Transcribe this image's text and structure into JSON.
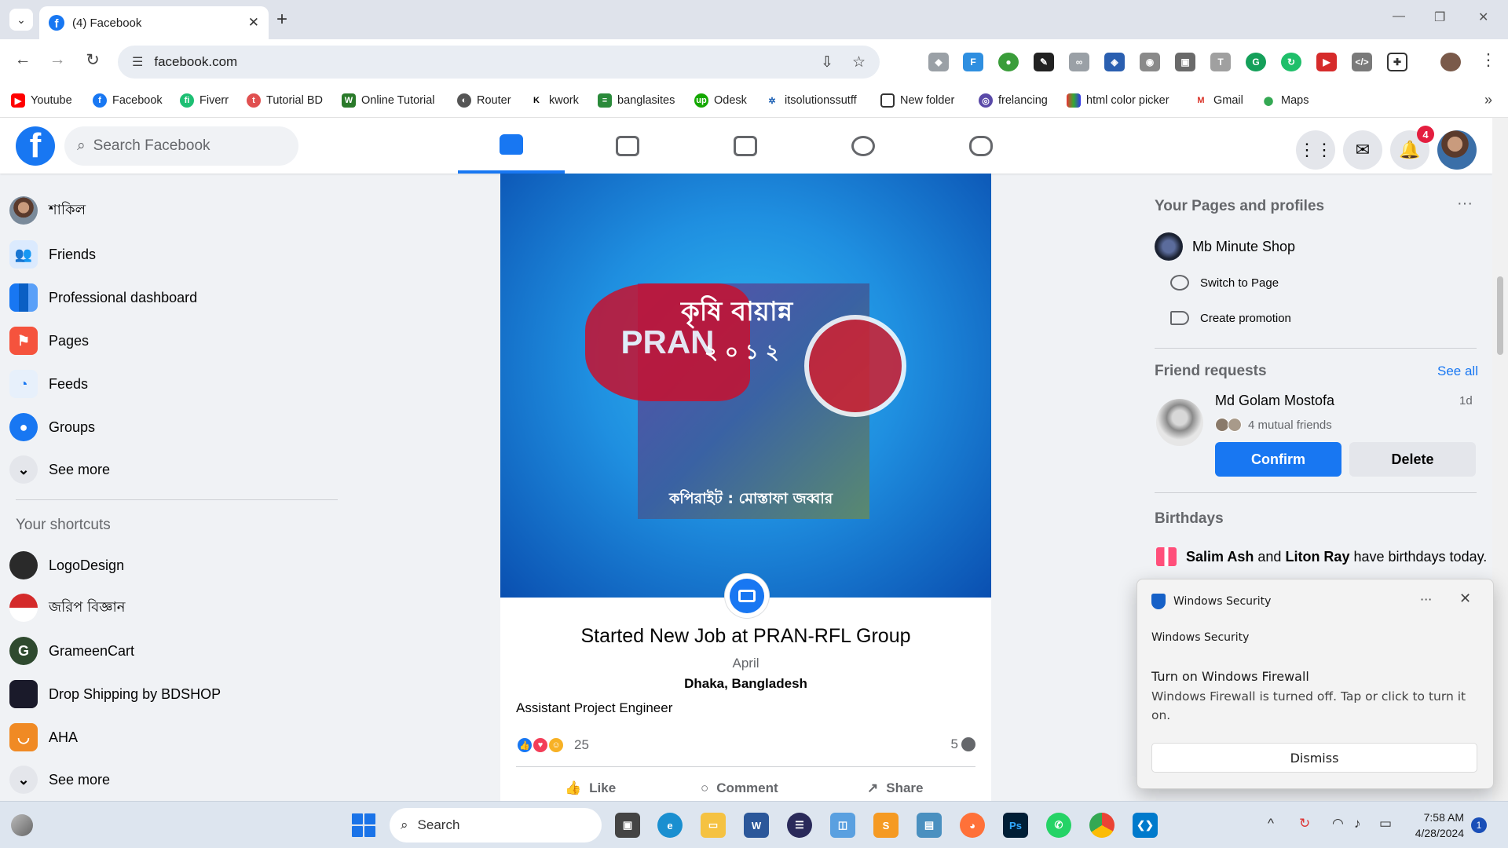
{
  "browser": {
    "tab_title": "(4) Facebook",
    "url": "facebook.com",
    "bookmarks": [
      "Youtube",
      "Facebook",
      "Fiverr",
      "Tutorial BD",
      "Online Tutorial",
      "Router",
      "kwork",
      "banglasites",
      "Odesk",
      "itsolutionssutff",
      "New folder",
      "frelancing",
      "html color picker",
      "Gmail",
      "Maps"
    ]
  },
  "header": {
    "search_placeholder": "Search Facebook",
    "notification_count": "4",
    "nav_tabs": [
      "home",
      "watch",
      "marketplace",
      "groups",
      "gaming"
    ]
  },
  "left_nav": {
    "items": [
      "শাকিল",
      "Friends",
      "Professional dashboard",
      "Pages",
      "Feeds",
      "Groups",
      "See more"
    ],
    "shortcuts_title": "Your shortcuts",
    "shortcuts": [
      "LogoDesign",
      "জরিপ বিজ্ঞান",
      "GrameenCart",
      "Drop Shipping by BDSHOP",
      "AHA",
      "See more"
    ]
  },
  "post": {
    "cover_text_top": "কৃষি বায়ান্ন",
    "cover_text_mid": "২ ০ ১ ২",
    "cover_text_bottom": "কপিরাইট : মোস্তাফা জব্বার",
    "cover_brand": "PRAN",
    "title": "Started New Job at PRAN-RFL Group",
    "date": "April",
    "location": "Dhaka, Bangladesh",
    "role": "Assistant Project Engineer",
    "reaction_count": "25",
    "comment_count": "5",
    "actions": [
      "Like",
      "Comment",
      "Share"
    ]
  },
  "right": {
    "pages_title": "Your Pages and profiles",
    "page_name": "Mb Minute Shop",
    "switch_label": "Switch to Page",
    "promo_label": "Create promotion",
    "requests_title": "Friend requests",
    "see_all": "See all",
    "request_name": "Md Golam Mostofa",
    "request_time": "1d",
    "mutual": "4 mutual friends",
    "confirm": "Confirm",
    "delete": "Delete",
    "birthdays_title": "Birthdays",
    "bday_name1": "Salim Ash",
    "bday_and": "and",
    "bday_name2": "Liton Ray",
    "bday_text": "have birthdays today."
  },
  "toast": {
    "app": "Windows Security",
    "subtitle": "Windows Security",
    "headline": "Turn on Windows Firewall",
    "body": "Windows Firewall is turned off. Tap or click to turn it on.",
    "dismiss": "Dismiss"
  },
  "taskbar": {
    "search": "Search",
    "time": "7:58 AM",
    "date": "4/28/2024",
    "notifications": "1"
  },
  "colors": {
    "fb_blue": "#1877f2",
    "page_bg": "#f0f2f5",
    "badge_red": "#e41e3f"
  }
}
